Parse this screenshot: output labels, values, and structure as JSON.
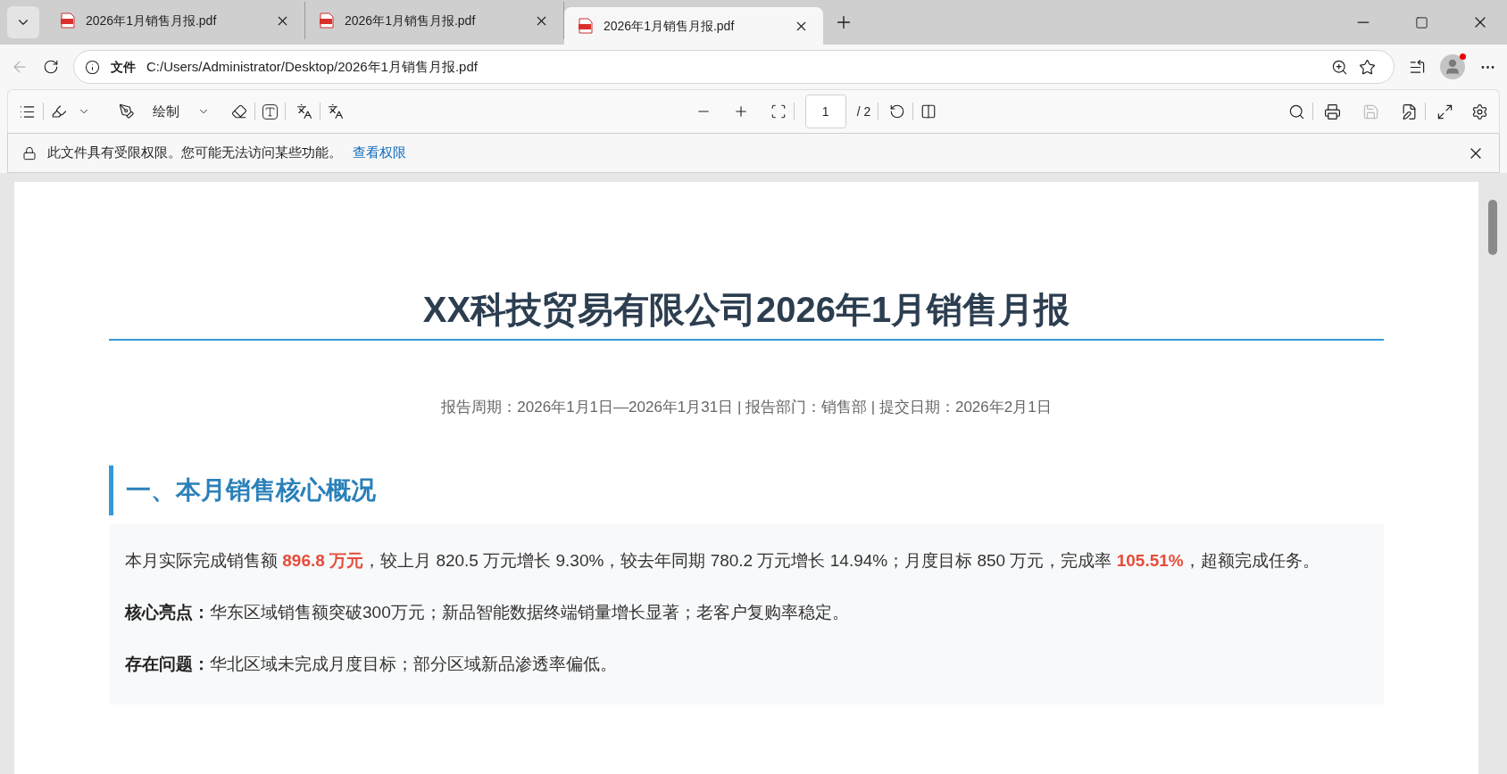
{
  "tabs": [
    {
      "title": "2026年1月销售月报.pdf",
      "selected": false
    },
    {
      "title": "2026年1月销售月报.pdf",
      "selected": false
    },
    {
      "title": "2026年1月销售月报.pdf",
      "selected": true
    }
  ],
  "address": {
    "scheme": "文件",
    "url": "C:/Users/Administrator/Desktop/2026年1月销售月报.pdf"
  },
  "toolbar": {
    "draw_label": "绘制",
    "page_number": "1",
    "page_total": "/ 2"
  },
  "info_bar": {
    "message": "此文件具有受限权限。您可能无法访问某些功能。",
    "link": "查看权限"
  },
  "document": {
    "title": "XX科技贸易有限公司2026年1月销售月报",
    "meta": "报告周期：2026年1月1日—2026年1月31日 | 报告部门：销售部 | 提交日期：2026年2月1日",
    "sections": [
      {
        "heading": "一、本月销售核心概况",
        "paragraphs": [
          [
            {
              "kind": "plain",
              "text": "本月实际完成销售额 "
            },
            {
              "kind": "highlight",
              "text": "896.8 万元"
            },
            {
              "kind": "plain",
              "text": "，较上月 820.5 万元增长 9.30%，较去年同期 780.2 万元增长 14.94%；月度目标 850 万元，完成率 "
            },
            {
              "kind": "highlight",
              "text": "105.51%"
            },
            {
              "kind": "plain",
              "text": "，超额完成任务。"
            }
          ],
          [
            {
              "kind": "label",
              "text": "核心亮点："
            },
            {
              "kind": "plain",
              "text": "华东区域销售额突破300万元；新品智能数据终端销量增长显著；老客户复购率稳定。"
            }
          ],
          [
            {
              "kind": "label",
              "text": "存在问题："
            },
            {
              "kind": "plain",
              "text": "华北区域未完成月度目标；部分区域新品渗透率偏低。"
            }
          ]
        ]
      }
    ]
  }
}
